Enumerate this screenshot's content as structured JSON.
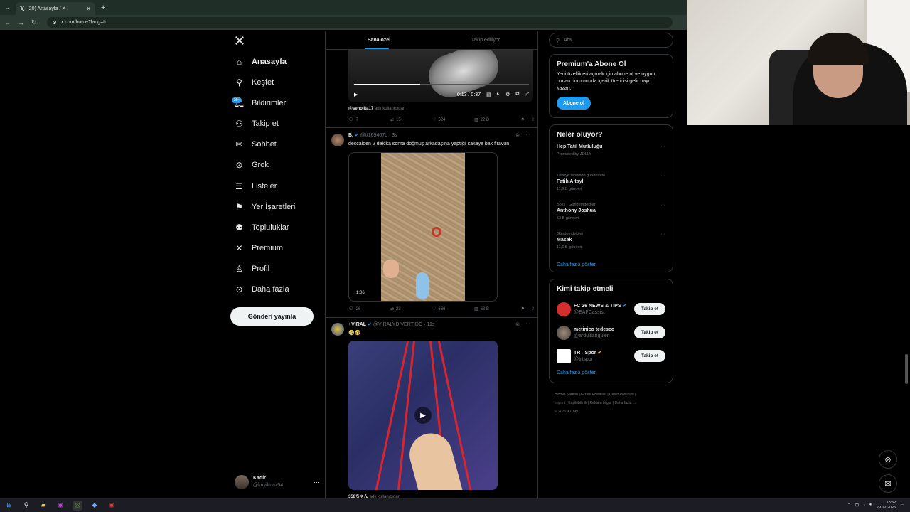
{
  "browser": {
    "tab_title": "(20) Anasayfa / X",
    "url": "x.com/home?lang=tr"
  },
  "nav": {
    "items": [
      {
        "label": "Anasayfa",
        "icon": "home-icon"
      },
      {
        "label": "Keşfet",
        "icon": "search-icon"
      },
      {
        "label": "Bildirimler",
        "icon": "bell-icon"
      },
      {
        "label": "Takip et",
        "icon": "follow-icon"
      },
      {
        "label": "Sohbet",
        "icon": "mail-icon"
      },
      {
        "label": "Grok",
        "icon": "grok-icon"
      },
      {
        "label": "Listeler",
        "icon": "list-icon"
      },
      {
        "label": "Yer İşaretleri",
        "icon": "bookmark-icon"
      },
      {
        "label": "Topluluklar",
        "icon": "communities-icon"
      },
      {
        "label": "Premium",
        "icon": "x-logo-icon"
      },
      {
        "label": "Profil",
        "icon": "profile-icon"
      },
      {
        "label": "Daha fazla",
        "icon": "more-circle-icon"
      }
    ],
    "notif_badge": "20+",
    "post_button": "Gönderi yayınla",
    "account_name": "Kadir",
    "account_handle": "@knyilmaz54"
  },
  "feed": {
    "tabs": [
      "Sana özel",
      "Takip ediliyor"
    ],
    "video1_time": "0:13 / 0:37",
    "video1_progress": 0.38,
    "post0": {
      "user_line_handle": "@senolita17",
      "user_line_suffix": "adlı kullanıcıdan",
      "replies": "7",
      "reposts": "15",
      "likes": "524",
      "views": "22 B"
    },
    "post1": {
      "name": "B,",
      "handle": "@tt169407b",
      "time": "3s",
      "text": "deccalden 2 dakika sonra doğmuş arkadaşına yaptığı şakaya bak firavun",
      "duration": "1:06",
      "replies": "26",
      "reposts": "23",
      "likes": "666",
      "views": "68 B"
    },
    "post2": {
      "name": "+VIRAL",
      "handle": "@VIRALYDIVERTIDO",
      "time": "11s",
      "text": "🤣🤣",
      "footer_handle": "358ちゃん",
      "footer_suffix": "adlı kullanıcıdan"
    }
  },
  "right": {
    "search_placeholder": "Ara",
    "premium": {
      "title": "Premium'a Abone Ol",
      "body": "Yeni özellikleri açmak için abone ol ve uygun olman durumunda içerik üreticisi gelir payı kazan.",
      "button": "Abone ol"
    },
    "trends": {
      "title": "Neler oluyor?",
      "items": [
        {
          "category": "",
          "name": "Hep Tatil Mutluluğu",
          "count": "Promoted by JOLLY"
        },
        {
          "category": "Türkiye tarihinde gündemde",
          "name": "Fatih Altaylı",
          "count": "11,6 B gönderi"
        },
        {
          "category": "Boks · Gündemdekiler",
          "name": "Anthony Joshua",
          "count": "53 B gönderi"
        },
        {
          "category": "Gündemdekiler",
          "name": "Masak",
          "count": "11,6 B gönderi"
        }
      ],
      "show_more": "Daha fazla göster"
    },
    "who_to_follow": {
      "title": "Kimi takip etmeli",
      "items": [
        {
          "name": "FC 26 NEWS & TIPS",
          "handle": "@EAFCassist",
          "button": "Takip et"
        },
        {
          "name": "metinico tedesco",
          "handle": "@ardulilahgulen",
          "button": "Takip et"
        },
        {
          "name": "TRT Spor",
          "handle": "@trtspor",
          "button": "Takip et"
        }
      ],
      "show_more": "Daha fazla göster"
    },
    "footer": {
      "line1": "Hizmet Şartları | Gizlilik Politikası | Çerez Politikası |",
      "line2": "Imprint | Erişilebilirlik | Reklam bilgisi | Daha fazla ...",
      "line3": "© 2025 X Corp."
    }
  },
  "taskbar": {
    "time": "18:52",
    "date": "29.12.2025"
  }
}
